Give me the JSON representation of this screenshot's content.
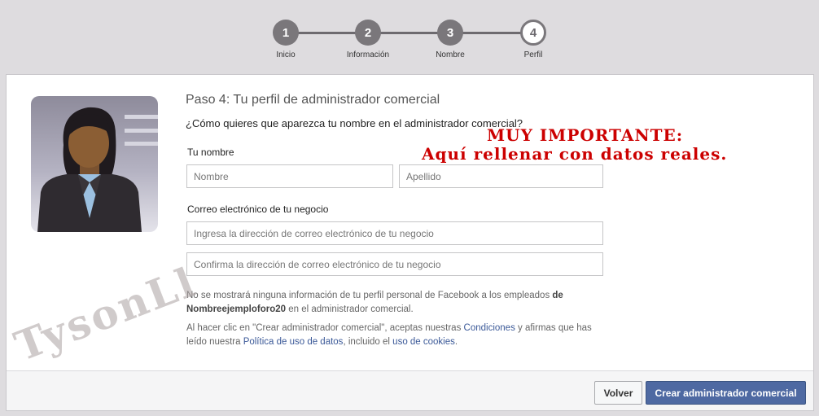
{
  "stepper": {
    "steps": [
      {
        "number": "1",
        "label": "Inicio"
      },
      {
        "number": "2",
        "label": "Información"
      },
      {
        "number": "3",
        "label": "Nombre"
      },
      {
        "number": "4",
        "label": "Perfil"
      }
    ],
    "active_step": 4
  },
  "dialog": {
    "title": "Paso 4: Tu perfil de administrador comercial",
    "question": "¿Cómo quieres que aparezca tu nombre en el administrador comercial?",
    "name_label": "Tu nombre",
    "first_name_placeholder": "Nombre",
    "last_name_placeholder": "Apellido",
    "email_label": "Correo electrónico de tu negocio",
    "email_placeholder": "Ingresa la dirección de correo electrónico de tu negocio",
    "email_confirm_placeholder": "Confirma la dirección de correo electrónico de tu negocio",
    "privacy_note": {
      "prefix": "No se mostrará ninguna información de tu perfil personal de Facebook a los empleados ",
      "business_name": "de Nombreejemploforo20",
      "suffix": " en el administrador comercial."
    },
    "terms_note": {
      "part1": "Al hacer clic en \"Crear administrador comercial\", aceptas nuestras ",
      "conditions_link": "Condiciones",
      "part2": " y afirmas que has leído nuestra ",
      "data_policy_link": "Política de uso de datos",
      "part3": ", incluido el ",
      "cookies_link": "uso de cookies",
      "part4": "."
    },
    "back_button": "Volver",
    "create_button": "Crear administrador comercial"
  },
  "annotation": {
    "line1": "MUY IMPORTANTE:",
    "line2": "Aquí rellenar con datos reales."
  },
  "watermark": "TysonLl",
  "colors": {
    "primary_button": "#4e69a2",
    "annotation": "#cc0000",
    "link": "#3b5998"
  }
}
